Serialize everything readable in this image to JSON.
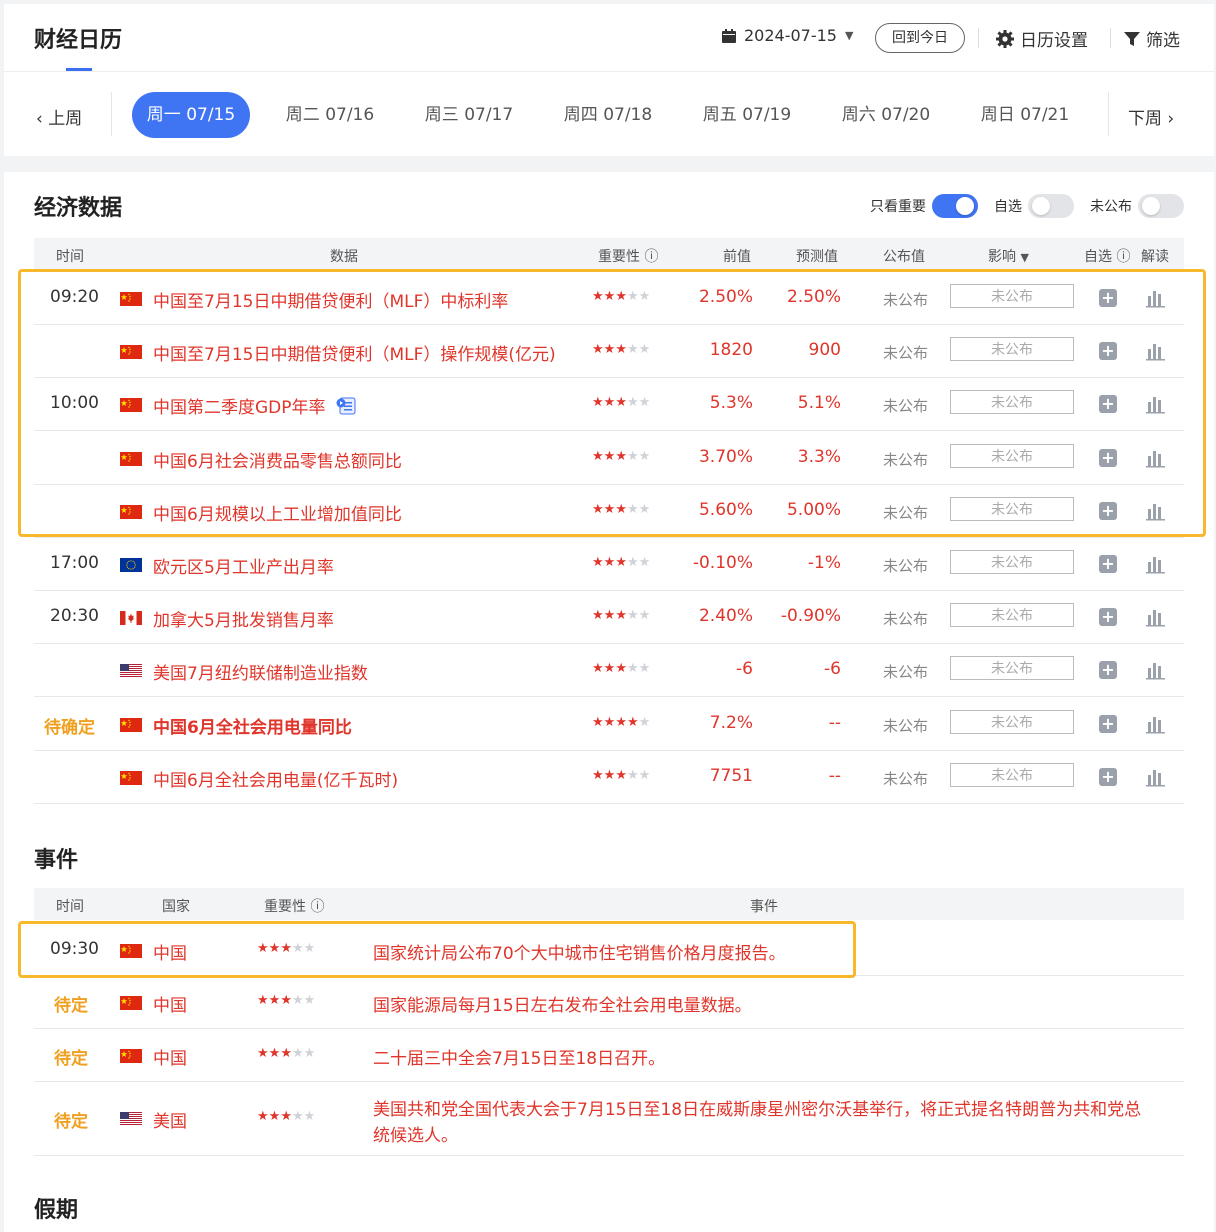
{
  "header": {
    "title": "财经日历",
    "date": "2024-07-15",
    "today_btn": "回到今日",
    "settings": "日历设置",
    "filter": "筛选"
  },
  "week_nav": {
    "prev": "上周",
    "next": "下周",
    "days": [
      "周一 07/15",
      "周二 07/16",
      "周三 07/17",
      "周四 07/18",
      "周五 07/19",
      "周六 07/20",
      "周日 07/21"
    ],
    "active_index": 0
  },
  "economic": {
    "title": "经济数据",
    "toggles": [
      {
        "label": "只看重要",
        "on": true
      },
      {
        "label": "自选",
        "on": false
      },
      {
        "label": "未公布",
        "on": false
      }
    ],
    "columns": {
      "time": "时间",
      "data": "数据",
      "importance": "重要性",
      "prev": "前值",
      "forecast": "预测值",
      "actual": "公布值",
      "impact": "影响",
      "watch": "自选",
      "interpret": "解读"
    },
    "rows": [
      {
        "time": "09:20",
        "flag": "cn",
        "title": "中国至7月15日中期借贷便利（MLF）中标利率",
        "stars": 3,
        "prev": "2.50%",
        "forecast": "2.50%",
        "actual": "未公布",
        "impact": "未公布"
      },
      {
        "time": "",
        "flag": "cn",
        "title": "中国至7月15日中期借贷便利（MLF）操作规模(亿元)",
        "stars": 3,
        "prev": "1820",
        "forecast": "900",
        "actual": "未公布",
        "impact": "未公布"
      },
      {
        "time": "10:00",
        "flag": "cn",
        "title": "中国第二季度GDP年率",
        "stars": 3,
        "prev": "5.3%",
        "forecast": "5.1%",
        "actual": "未公布",
        "impact": "未公布"
      },
      {
        "time": "",
        "flag": "cn",
        "title": "中国6月社会消费品零售总额同比",
        "stars": 3,
        "prev": "3.70%",
        "forecast": "3.3%",
        "actual": "未公布",
        "impact": "未公布"
      },
      {
        "time": "",
        "flag": "cn",
        "title": "中国6月规模以上工业增加值同比",
        "stars": 3,
        "prev": "5.60%",
        "forecast": "5.00%",
        "actual": "未公布",
        "impact": "未公布"
      },
      {
        "time": "17:00",
        "flag": "eu",
        "title": "欧元区5月工业产出月率",
        "stars": 3,
        "prev": "-0.10%",
        "forecast": "-1%",
        "actual": "未公布",
        "impact": "未公布"
      },
      {
        "time": "20:30",
        "flag": "ca",
        "title": "加拿大5月批发销售月率",
        "stars": 3,
        "prev": "2.40%",
        "forecast": "-0.90%",
        "actual": "未公布",
        "impact": "未公布"
      },
      {
        "time": "",
        "flag": "us",
        "title": "美国7月纽约联储制造业指数",
        "stars": 3,
        "prev": "-6",
        "forecast": "-6",
        "actual": "未公布",
        "impact": "未公布"
      },
      {
        "time": "待确定",
        "flag": "cn",
        "title": "中国6月全社会用电量同比",
        "stars": 4,
        "prev": "7.2%",
        "forecast": "--",
        "actual": "未公布",
        "impact": "未公布"
      },
      {
        "time": "",
        "flag": "cn",
        "title": "中国6月全社会用电量(亿千瓦时)",
        "stars": 3,
        "prev": "7751",
        "forecast": "--",
        "actual": "未公布",
        "impact": "未公布"
      }
    ]
  },
  "events": {
    "title": "事件",
    "columns": {
      "time": "时间",
      "country": "国家",
      "importance": "重要性",
      "event": "事件"
    },
    "rows": [
      {
        "time": "09:30",
        "flag": "cn",
        "country": "中国",
        "stars": 3,
        "text": "国家统计局公布70个大中城市住宅销售价格月度报告。"
      },
      {
        "time": "待定",
        "flag": "cn",
        "country": "中国",
        "stars": 3,
        "text": "国家能源局每月15日左右发布全社会用电量数据。"
      },
      {
        "time": "待定",
        "flag": "cn",
        "country": "中国",
        "stars": 3,
        "text": "二十届三中全会7月15日至18日召开。"
      },
      {
        "time": "待定",
        "flag": "us",
        "country": "美国",
        "stars": 3,
        "text": "美国共和党全国代表大会于7月15日至18日在威斯康星州密尔沃基举行，将正式提名特朗普为共和党总",
        "text2": "统候选人。"
      }
    ]
  },
  "holidays": {
    "title": "假期"
  }
}
